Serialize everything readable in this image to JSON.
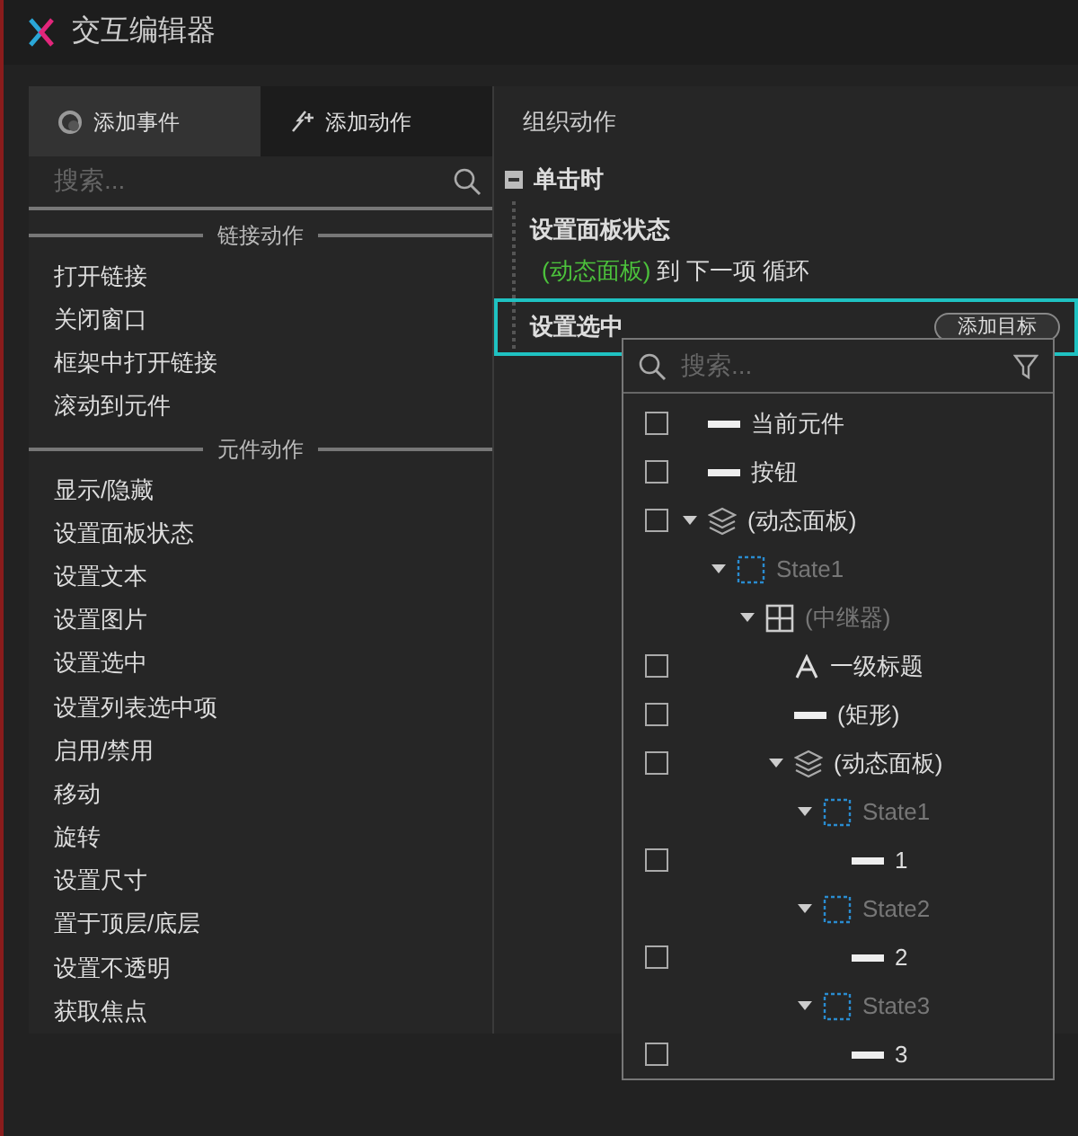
{
  "window": {
    "title": "交互编辑器"
  },
  "tabs": [
    {
      "label": "添加事件",
      "kind": "event",
      "selected": true
    },
    {
      "label": "添加动作",
      "kind": "action",
      "selected": false
    }
  ],
  "action_search": {
    "placeholder": "搜索..."
  },
  "action_groups": [
    {
      "heading": "链接动作",
      "items": [
        "打开链接",
        "关闭窗口",
        "框架中打开链接",
        "滚动到元件"
      ]
    },
    {
      "heading": "元件动作",
      "items": [
        "显示/隐藏",
        "设置面板状态",
        "设置文本",
        "设置图片",
        "设置选中",
        "设置列表选中项",
        "启用/禁用",
        "移动",
        "旋转",
        "设置尺寸",
        "置于顶层/底层",
        "设置不透明",
        "获取焦点"
      ]
    }
  ],
  "organize": {
    "title": "组织动作",
    "event": {
      "label": "单击时",
      "expanded": true
    },
    "actions": [
      {
        "name": "设置面板状态",
        "selected": false,
        "target": "(动态面板)",
        "detail": "到 下一项 循环"
      },
      {
        "name": "设置选中",
        "selected": true,
        "button": "添加目标"
      }
    ]
  },
  "target_picker": {
    "search_placeholder": "搜索...",
    "tree": [
      {
        "label": "当前元件",
        "kind": "widget",
        "checked": false
      },
      {
        "label": "按钮",
        "kind": "widget",
        "checked": false
      },
      {
        "label": "(动态面板)",
        "kind": "panel",
        "checked": false,
        "expanded": true,
        "children": [
          {
            "label": "State1",
            "kind": "state",
            "expanded": true,
            "children": [
              {
                "label": "(中继器)",
                "kind": "repeater",
                "expanded": true,
                "children": [
                  {
                    "label": "一级标题",
                    "kind": "text",
                    "checked": false
                  },
                  {
                    "label": "(矩形)",
                    "kind": "widget",
                    "checked": false
                  },
                  {
                    "label": "(动态面板)",
                    "kind": "panel",
                    "checked": false,
                    "expanded": true,
                    "children": [
                      {
                        "label": "State1",
                        "kind": "state",
                        "expanded": true,
                        "children": [
                          {
                            "label": "1",
                            "kind": "widget",
                            "checked": false
                          }
                        ]
                      },
                      {
                        "label": "State2",
                        "kind": "state",
                        "expanded": true,
                        "children": [
                          {
                            "label": "2",
                            "kind": "widget",
                            "checked": false
                          }
                        ]
                      },
                      {
                        "label": "State3",
                        "kind": "state",
                        "expanded": true,
                        "children": [
                          {
                            "label": "3",
                            "kind": "widget",
                            "checked": false
                          }
                        ]
                      }
                    ]
                  }
                ]
              }
            ]
          }
        ]
      }
    ]
  }
}
